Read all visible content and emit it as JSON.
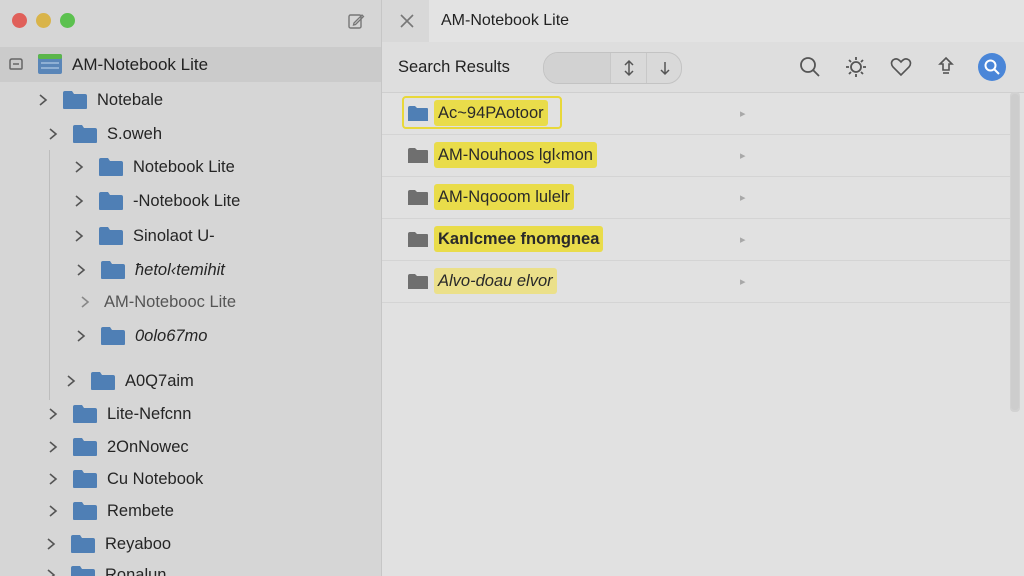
{
  "window": {
    "traffic_lights": [
      "close",
      "minimize",
      "zoom"
    ],
    "colors": {
      "red": "#e0605a",
      "yellow": "#d9b44a",
      "green": "#5cc14f",
      "accent": "#4a86d8",
      "highlight": "#e9dc4a"
    }
  },
  "sidebar": {
    "root": {
      "label": "AM-Notebook Lite",
      "icon": "notebook-icon"
    },
    "items": [
      {
        "label": "Notebale",
        "icon": "folder-icon"
      },
      {
        "label": "S.oweh",
        "icon": "folder-icon"
      },
      {
        "label": "Notebook Lite",
        "icon": "folder-icon"
      },
      {
        "label": "-Notebook Lite",
        "icon": "folder-icon"
      },
      {
        "label": "Sinolaot U-",
        "icon": "folder-icon"
      },
      {
        "label": "ħetol‹temihit",
        "icon": "folder-icon"
      },
      {
        "label": "AM-Noteboo⁠c Lite",
        "icon": "none"
      },
      {
        "label": "0olo67mo",
        "icon": "folder-icon"
      },
      {
        "label": "A0Q7aim",
        "icon": "folder-icon"
      },
      {
        "label": "Lite-Nefcnn",
        "icon": "folder-icon"
      },
      {
        "label": "2OnNowec",
        "icon": "folder-icon"
      },
      {
        "label": "Cu Notebook",
        "icon": "folder-icon"
      },
      {
        "label": "Rembete",
        "icon": "folder-icon"
      },
      {
        "label": "Reyaboo",
        "icon": "folder-icon"
      },
      {
        "label": "Ronalun",
        "icon": "folder-icon"
      }
    ]
  },
  "tab": {
    "label": "AM-Notebook Lite"
  },
  "toolbar": {
    "title": "Search Results",
    "sort_icon": "sort-updown-icon",
    "down_icon": "arrow-down-icon",
    "icons": [
      "search-icon",
      "gear-icon",
      "heart-icon",
      "pin-icon",
      "search-active-icon"
    ]
  },
  "results": [
    {
      "label": "Ac~94PAotoor",
      "style": "normal"
    },
    {
      "label": "AM-Nouhoos lgl‹mon",
      "style": "normal"
    },
    {
      "label": "AM-Nqooom lulelr",
      "style": "normal"
    },
    {
      "label": "Kanlcmee fnomgnea",
      "style": "bold"
    },
    {
      "label": "Alvo-doau elvor",
      "style": "italic"
    }
  ]
}
